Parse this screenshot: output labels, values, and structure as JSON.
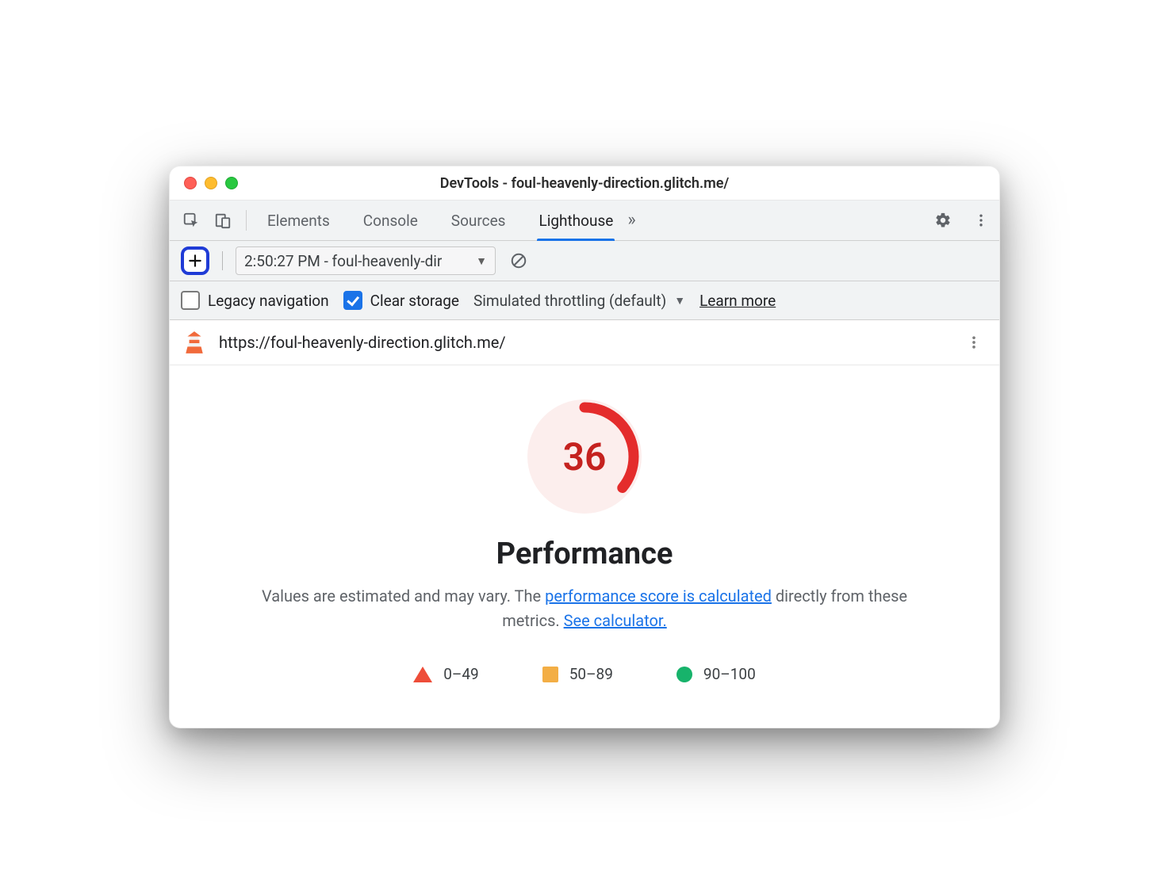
{
  "window": {
    "title": "DevTools - foul-heavenly-direction.glitch.me/"
  },
  "tabs": {
    "items": [
      "Elements",
      "Console",
      "Sources",
      "Lighthouse"
    ],
    "active": "Lighthouse"
  },
  "actionbar": {
    "report_label": "2:50:27 PM - foul-heavenly-dir"
  },
  "options": {
    "legacy_label": "Legacy navigation",
    "legacy_checked": false,
    "clear_label": "Clear storage",
    "clear_checked": true,
    "throttling_label": "Simulated throttling (default)",
    "learn_more": "Learn more"
  },
  "urlbar": {
    "url": "https://foul-heavenly-direction.glitch.me/"
  },
  "report": {
    "score": "36",
    "category": "Performance",
    "desc_prefix": "Values are estimated and may vary. The ",
    "desc_link1": "performance score is calculated",
    "desc_mid": " directly from these metrics. ",
    "desc_link2": "See calculator.",
    "legend": {
      "low": "0–49",
      "mid": "50–89",
      "high": "90–100"
    }
  },
  "chart_data": {
    "type": "pie",
    "title": "Performance",
    "categories": [
      "score",
      "remaining"
    ],
    "values": [
      36,
      64
    ],
    "ylim": [
      0,
      100
    ],
    "series": [
      {
        "name": "Performance",
        "values": [
          36
        ]
      }
    ],
    "colors": {
      "score": "#e42c2c",
      "track": "#fceeed"
    }
  }
}
